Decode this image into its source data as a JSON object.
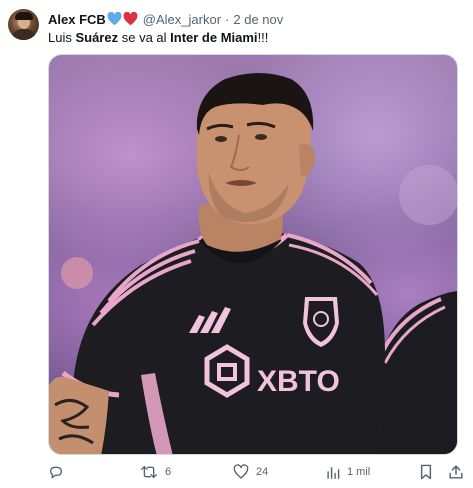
{
  "tweet": {
    "author_name": "Alex FCB",
    "handle": "@Alex_jarkor",
    "separator": "·",
    "date": "2 de nov",
    "text_parts": [
      "Luis ",
      "Suárez",
      " se va al ",
      "Inter de Miami",
      "!!!"
    ],
    "media": {
      "jersey_sponsor": "XBTO",
      "description_colors": {
        "jersey": "#1a1a1e",
        "trim": "#e8a6c8",
        "background": "#9d7bb0"
      }
    },
    "actions": {
      "reply_count": "",
      "retweet_count": "6",
      "like_count": "24",
      "views_count": "1 mil"
    },
    "icons": {
      "hearts": [
        "blue-heart-icon",
        "red-heart-icon"
      ],
      "reply": "reply-icon",
      "retweet": "retweet-icon",
      "like": "like-icon",
      "views": "views-icon",
      "bookmark": "bookmark-icon",
      "share": "share-icon"
    },
    "colors": {
      "text": "#0f1419",
      "muted": "#536471",
      "blue_heart": "#5da9e9",
      "red_heart": "#dd2e44"
    }
  }
}
